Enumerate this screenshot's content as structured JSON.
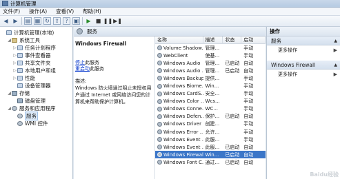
{
  "window": {
    "title": "计算机管理"
  },
  "menu": [
    "文件(F)",
    "操作(A)",
    "查看(V)",
    "帮助(H)"
  ],
  "toolbar": {
    "icons": [
      "back-icon",
      "forward-icon",
      "up-folder-icon",
      "show-tree-icon",
      "refresh-icon",
      "export-icon",
      "help-icon",
      "view-icon",
      "play-icon",
      "stop-icon",
      "pause-icon",
      "restart-icon"
    ],
    "glyphs": [
      "◀",
      "▶",
      "▤",
      "▦",
      "↻",
      "⇪",
      "?",
      "▣",
      "▶",
      "■",
      "❚❚",
      "▶❚"
    ]
  },
  "tree": [
    {
      "label": "计算机管理(本地)",
      "level": 0,
      "expander": "",
      "icon": "computer-icon"
    },
    {
      "label": "系统工具",
      "level": 1,
      "expander": "◢",
      "icon": "tools-icon"
    },
    {
      "label": "任务计划程序",
      "level": 2,
      "expander": "▷",
      "icon": "task-scheduler-icon"
    },
    {
      "label": "事件查看器",
      "level": 2,
      "expander": "▷",
      "icon": "event-viewer-icon"
    },
    {
      "label": "共享文件夹",
      "level": 2,
      "expander": "▷",
      "icon": "shared-folder-icon"
    },
    {
      "label": "本地用户和组",
      "level": 2,
      "expander": "▷",
      "icon": "users-icon"
    },
    {
      "label": "性能",
      "level": 2,
      "expander": "▷",
      "icon": "performance-icon"
    },
    {
      "label": "设备管理器",
      "level": 2,
      "expander": "",
      "icon": "device-manager-icon"
    },
    {
      "label": "存储",
      "level": 1,
      "expander": "◢",
      "icon": "storage-icon"
    },
    {
      "label": "磁盘管理",
      "level": 2,
      "expander": "",
      "icon": "disk-icon"
    },
    {
      "label": "服务和应用程序",
      "level": 1,
      "expander": "◢",
      "icon": "services-apps-icon"
    },
    {
      "label": "服务",
      "level": 2,
      "expander": "",
      "icon": "services-icon",
      "selected": true
    },
    {
      "label": "WMI 控件",
      "level": 2,
      "expander": "",
      "icon": "wmi-icon"
    }
  ],
  "middle": {
    "header": "服务",
    "detail": {
      "service_name": "Windows Firewall",
      "stop_link": "停止",
      "stop_suffix": "此服务",
      "restart_link": "重启动",
      "restart_suffix": "此服务",
      "desc_label": "描述:",
      "desc_text": "Windows 防火墙通过阻止未授权用户通过 Internet 或网络访问您的计算机来帮助保护计算机。"
    },
    "columns": [
      "名称",
      "描述",
      "状态",
      "启动"
    ],
    "rows": [
      {
        "name": "Volume Shadow...",
        "desc": "管理...",
        "status": "",
        "startup": "手动"
      },
      {
        "name": "WebClient",
        "desc": "使基...",
        "status": "",
        "startup": "手动"
      },
      {
        "name": "Windows Audio",
        "desc": "管理...",
        "status": "已启动",
        "startup": "自动"
      },
      {
        "name": "Windows Audio ...",
        "desc": "管理...",
        "status": "已启动",
        "startup": "自动"
      },
      {
        "name": "Windows Backup",
        "desc": "提供...",
        "status": "",
        "startup": "手动"
      },
      {
        "name": "Windows Biome...",
        "desc": "Win...",
        "status": "",
        "startup": "手动"
      },
      {
        "name": "Windows CardS...",
        "desc": "安全...",
        "status": "",
        "startup": "手动"
      },
      {
        "name": "Windows Color ...",
        "desc": "Wcs...",
        "status": "",
        "startup": "手动"
      },
      {
        "name": "Windows Conne...",
        "desc": "WC...",
        "status": "",
        "startup": "手动"
      },
      {
        "name": "Windows Defen...",
        "desc": "保护...",
        "status": "已启动",
        "startup": "自动"
      },
      {
        "name": "Windows Driver ...",
        "desc": "创建...",
        "status": "",
        "startup": "手动"
      },
      {
        "name": "Windows Error ...",
        "desc": "允许...",
        "status": "",
        "startup": "手动"
      },
      {
        "name": "Windows Event ...",
        "desc": "此服...",
        "status": "",
        "startup": "手动"
      },
      {
        "name": "Windows Event ...",
        "desc": "此服...",
        "status": "已启动",
        "startup": "自动"
      },
      {
        "name": "Windows Firewall",
        "desc": "Win...",
        "status": "已启动",
        "startup": "自动",
        "selected": true
      },
      {
        "name": "Windows Font C...",
        "desc": "通过...",
        "status": "已启动",
        "startup": "自动"
      }
    ]
  },
  "actions": {
    "header": "操作",
    "sections": [
      {
        "title": "服务",
        "items": [
          "更多操作"
        ]
      },
      {
        "title": "Windows Firewall",
        "items": [
          "更多操作"
        ]
      }
    ]
  },
  "watermark": "Baidu经验"
}
